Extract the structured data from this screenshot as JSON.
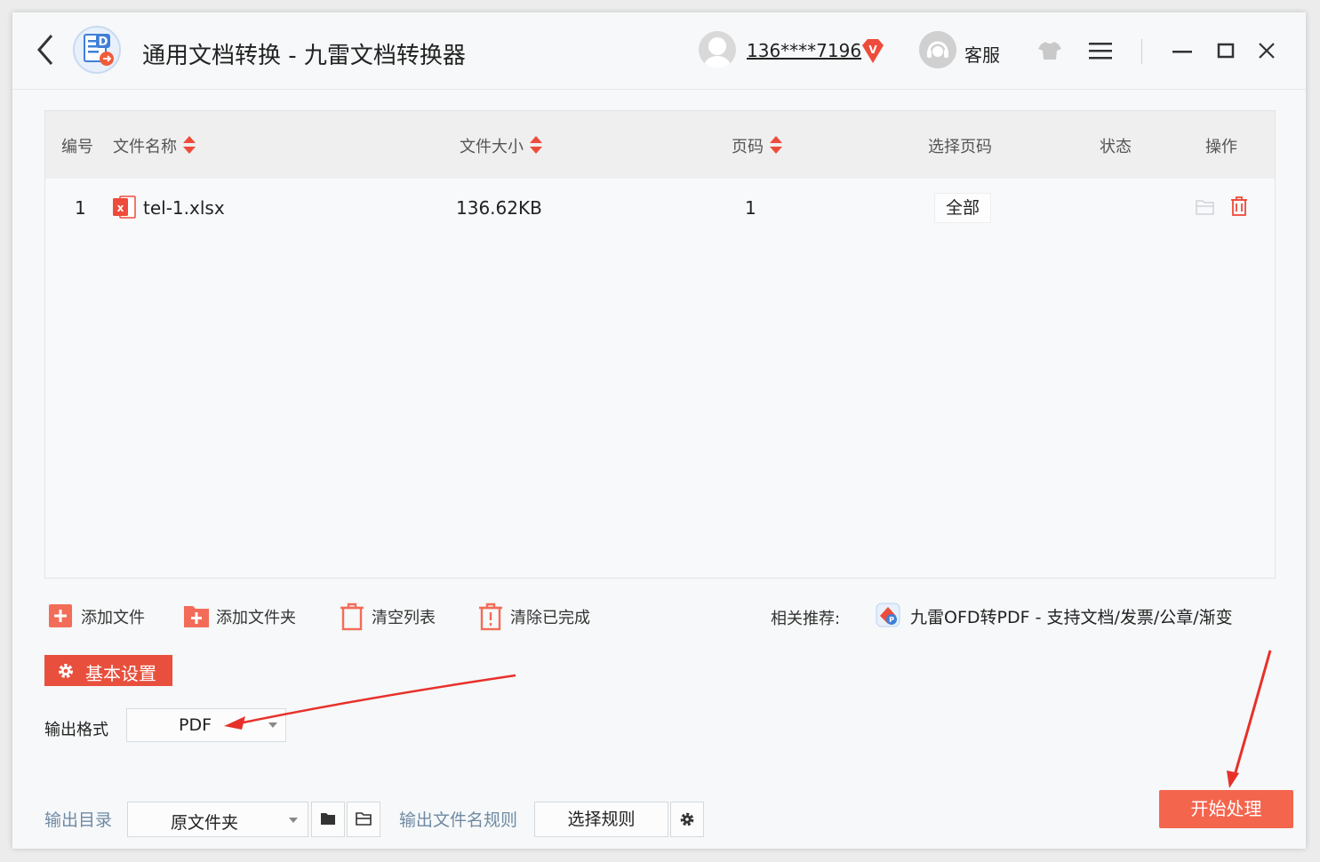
{
  "titlebar": {
    "title": "通用文档转换 - 九雷文档转换器",
    "user_name": "136****7196",
    "vip_badge": "V",
    "service_label": "客服"
  },
  "table": {
    "columns": [
      "编号",
      "文件名称",
      "文件大小",
      "页码",
      "选择页码",
      "状态",
      "操作"
    ],
    "rows": [
      {
        "index": "1",
        "file_name": "tel-1.xlsx",
        "file_size": "136.62KB",
        "pages": "1",
        "selected_pages": "全部",
        "status": ""
      }
    ]
  },
  "actions": {
    "add_file": "添加文件",
    "add_folder": "添加文件夹",
    "clear_list": "清空列表",
    "clear_done": "清除已完成"
  },
  "recommend": {
    "label": "相关推荐:",
    "link": "九雷OFD转PDF - 支持文档/发票/公章/渐变"
  },
  "settings": {
    "tab_label": "基本设置",
    "format_label": "输出格式",
    "format_value": "PDF",
    "dir_label": "输出目录",
    "dir_value": "原文件夹",
    "rule_label": "输出文件名规则",
    "rule_button": "选择规则",
    "start_button": "开始处理"
  },
  "colors": {
    "accent": "#e8503d",
    "start_button": "#f4654e",
    "label_blue": "#6f8aa3"
  }
}
